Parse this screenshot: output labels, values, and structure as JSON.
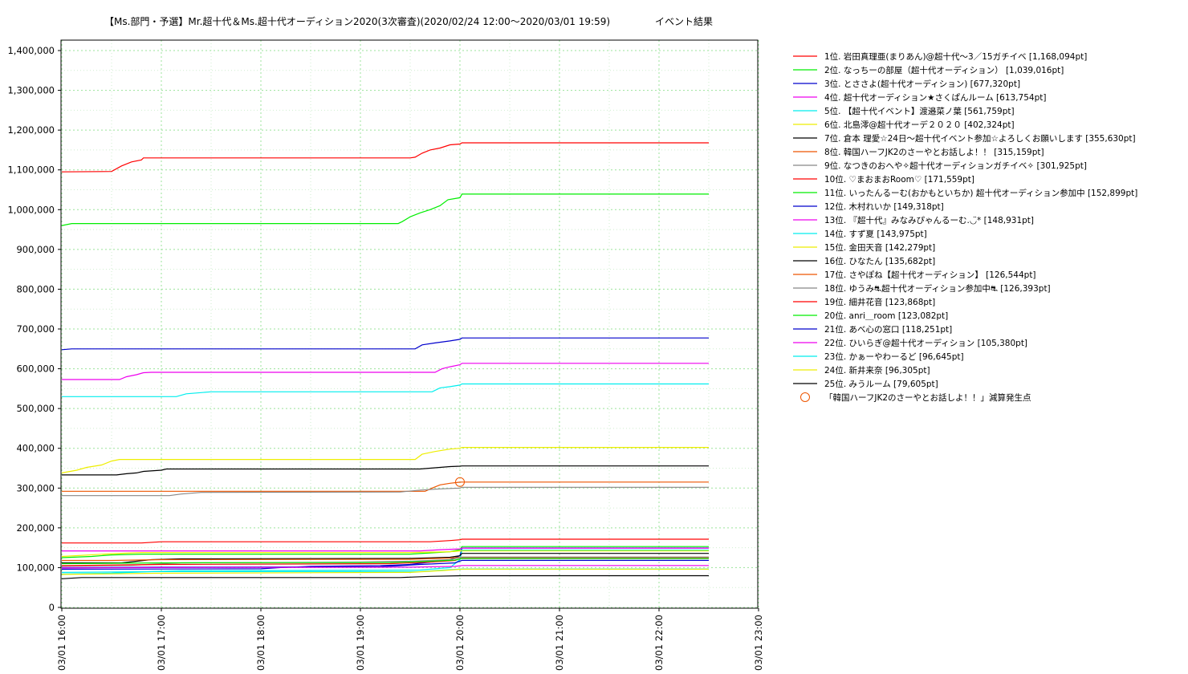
{
  "chart_data": {
    "type": "line",
    "title": "【Ms.部門・予選】Mr.超十代＆Ms.超十代オーディション2020(3次審査)(2020/02/24 12:00～2020/03/01 19:59)",
    "subtitle": "イベント結果",
    "xlabel": "",
    "ylabel": "",
    "x_tick_labels": [
      "03/01 16:00",
      "03/01 17:00",
      "03/01 18:00",
      "03/01 19:00",
      "03/01 20:00",
      "03/01 21:00",
      "03/01 22:00",
      "03/01 23:00"
    ],
    "y_tick_labels": [
      "0",
      "100,000",
      "200,000",
      "300,000",
      "400,000",
      "500,000",
      "600,000",
      "700,000",
      "800,000",
      "900,000",
      "1,000,000",
      "1,100,000",
      "1,200,000",
      "1,300,000",
      "1,400,000"
    ],
    "xlim": [
      0,
      7
    ],
    "ylim": [
      0,
      1420000
    ],
    "grid": true,
    "legend_position": "right",
    "series": [
      {
        "name": "1位. 岩田真理亜(まりあん)@超十代～3／15ガチイベ [1,168,094pt]",
        "color": "#ff0000",
        "points": [
          [
            0,
            1095000
          ],
          [
            0.5,
            1096000
          ],
          [
            0.6,
            1110000
          ],
          [
            0.7,
            1120000
          ],
          [
            0.8,
            1125000
          ],
          [
            0.82,
            1130000
          ],
          [
            3.5,
            1130000
          ],
          [
            3.55,
            1132000
          ],
          [
            3.62,
            1142000
          ],
          [
            3.7,
            1150000
          ],
          [
            3.8,
            1155000
          ],
          [
            3.9,
            1163000
          ],
          [
            4.0,
            1165000
          ],
          [
            4.02,
            1168094
          ],
          [
            6.5,
            1168094
          ]
        ]
      },
      {
        "name": "2位. なっちーの部屋（超十代オーディション） [1,039,016pt]",
        "color": "#00ee00",
        "points": [
          [
            0,
            960000
          ],
          [
            0.1,
            965000
          ],
          [
            3.38,
            965000
          ],
          [
            3.42,
            970000
          ],
          [
            3.5,
            982000
          ],
          [
            3.6,
            992000
          ],
          [
            3.7,
            1000000
          ],
          [
            3.8,
            1010000
          ],
          [
            3.88,
            1025000
          ],
          [
            4.0,
            1030000
          ],
          [
            4.02,
            1039016
          ],
          [
            6.5,
            1039016
          ]
        ]
      },
      {
        "name": "3位. とささよ(超十代オーディション) [677,320pt]",
        "color": "#0000cc",
        "points": [
          [
            0,
            648000
          ],
          [
            0.1,
            650000
          ],
          [
            3.55,
            650000
          ],
          [
            3.62,
            660000
          ],
          [
            3.75,
            665000
          ],
          [
            3.9,
            670000
          ],
          [
            4.0,
            674000
          ],
          [
            4.02,
            677320
          ],
          [
            6.5,
            677320
          ]
        ]
      },
      {
        "name": "4位. 超十代オーディション★さくぱんルーム [613,754pt]",
        "color": "#ee00ee",
        "points": [
          [
            0,
            573000
          ],
          [
            0.58,
            573000
          ],
          [
            0.65,
            580000
          ],
          [
            0.75,
            585000
          ],
          [
            0.82,
            590000
          ],
          [
            0.9,
            591000
          ],
          [
            3.75,
            591000
          ],
          [
            3.82,
            600000
          ],
          [
            3.9,
            605000
          ],
          [
            4.0,
            610000
          ],
          [
            4.02,
            613754
          ],
          [
            6.5,
            613754
          ]
        ]
      },
      {
        "name": "5位. 【超十代イベント】渡邉菜ノ葉 [561,759pt]",
        "color": "#00eeee",
        "points": [
          [
            0,
            530000
          ],
          [
            1.15,
            530000
          ],
          [
            1.25,
            537000
          ],
          [
            1.4,
            540000
          ],
          [
            1.5,
            542000
          ],
          [
            3.72,
            542000
          ],
          [
            3.8,
            552000
          ],
          [
            3.9,
            555000
          ],
          [
            4.0,
            559000
          ],
          [
            4.02,
            561759
          ],
          [
            6.5,
            561759
          ]
        ]
      },
      {
        "name": "6位. 北島澪@超十代オーデ２０２０ [402,324pt]",
        "color": "#eeee00",
        "points": [
          [
            0,
            338000
          ],
          [
            0.15,
            345000
          ],
          [
            0.25,
            352000
          ],
          [
            0.4,
            358000
          ],
          [
            0.5,
            368000
          ],
          [
            0.58,
            372000
          ],
          [
            3.55,
            372000
          ],
          [
            3.62,
            385000
          ],
          [
            3.75,
            392000
          ],
          [
            3.9,
            398000
          ],
          [
            4.0,
            400000
          ],
          [
            4.02,
            402324
          ],
          [
            6.5,
            402324
          ]
        ]
      },
      {
        "name": "7位. 倉本 理愛☆24日～超十代イベント参加☆よろしくお願いします [355,630pt]",
        "color": "#000000",
        "points": [
          [
            0,
            333000
          ],
          [
            0.55,
            333000
          ],
          [
            0.65,
            336000
          ],
          [
            0.75,
            338000
          ],
          [
            0.82,
            342000
          ],
          [
            1.0,
            345000
          ],
          [
            1.05,
            348000
          ],
          [
            3.6,
            348000
          ],
          [
            3.75,
            351000
          ],
          [
            3.9,
            354000
          ],
          [
            4.0,
            355000
          ],
          [
            4.02,
            355630
          ],
          [
            6.5,
            355630
          ]
        ]
      },
      {
        "name": "8位. 韓国ハーフJK2のさーやとお話しよ！！ [315,159pt]",
        "color": "#ee5500",
        "points": [
          [
            0,
            292000
          ],
          [
            3.65,
            292000
          ],
          [
            3.72,
            300000
          ],
          [
            3.8,
            308000
          ],
          [
            3.9,
            312000
          ],
          [
            4.0,
            315000
          ],
          [
            4.02,
            315159
          ],
          [
            6.5,
            315159
          ]
        ]
      },
      {
        "name": "9位. なつきのおへや✧超十代オーディションガチイベ✧ [301,925pt]",
        "color": "#888888",
        "points": [
          [
            0,
            281000
          ],
          [
            1.08,
            281000
          ],
          [
            1.2,
            285000
          ],
          [
            1.4,
            289000
          ],
          [
            3.4,
            290000
          ],
          [
            3.6,
            295000
          ],
          [
            3.8,
            298000
          ],
          [
            4.0,
            300000
          ],
          [
            4.02,
            301925
          ],
          [
            6.5,
            301925
          ]
        ]
      },
      {
        "name": "10位. ♡まおまおRoom♡ [171,559pt]",
        "color": "#ff0000",
        "points": [
          [
            0,
            162000
          ],
          [
            0.8,
            162000
          ],
          [
            1.0,
            165000
          ],
          [
            3.7,
            165000
          ],
          [
            3.9,
            168000
          ],
          [
            4.0,
            170000
          ],
          [
            4.02,
            171559
          ],
          [
            6.5,
            171559
          ]
        ]
      },
      {
        "name": "11位. いったんるーむ(おかもといちか) 超十代オーディション参加中 [152,899pt]",
        "color": "#00ee00",
        "points": [
          [
            0,
            125000
          ],
          [
            0.3,
            128000
          ],
          [
            0.5,
            132000
          ],
          [
            0.8,
            134000
          ],
          [
            3.5,
            134000
          ],
          [
            3.9,
            140000
          ],
          [
            4.0,
            145000
          ],
          [
            4.02,
            152899
          ],
          [
            6.5,
            152899
          ]
        ]
      },
      {
        "name": "12位. 木村れいか [149,318pt]",
        "color": "#0000cc",
        "points": [
          [
            0,
            96000
          ],
          [
            2.0,
            97000
          ],
          [
            2.2,
            100000
          ],
          [
            2.5,
            103000
          ],
          [
            3.2,
            105000
          ],
          [
            3.5,
            108000
          ],
          [
            3.9,
            120000
          ],
          [
            4.0,
            130000
          ],
          [
            4.02,
            149318
          ],
          [
            6.5,
            149318
          ]
        ]
      },
      {
        "name": "13位. 『超十代』みなみぴゃんるーむ.◡̈* [148,931pt]",
        "color": "#ee00ee",
        "points": [
          [
            0,
            142000
          ],
          [
            3.6,
            142000
          ],
          [
            3.8,
            145000
          ],
          [
            4.0,
            147000
          ],
          [
            4.02,
            148931
          ],
          [
            6.5,
            148931
          ]
        ]
      },
      {
        "name": "14位. すず夏 [143,975pt]",
        "color": "#00eeee",
        "points": [
          [
            0,
            84000
          ],
          [
            0.5,
            86000
          ],
          [
            0.9,
            90000
          ],
          [
            1.2,
            92000
          ],
          [
            3.6,
            94000
          ],
          [
            3.9,
            100000
          ],
          [
            4.0,
            120000
          ],
          [
            4.02,
            143975
          ],
          [
            6.5,
            143975
          ]
        ]
      },
      {
        "name": "15位. 金田天音 [142,279pt]",
        "color": "#eeee00",
        "points": [
          [
            0,
            128000
          ],
          [
            0.5,
            135000
          ],
          [
            0.8,
            138000
          ],
          [
            3.5,
            138000
          ],
          [
            3.9,
            140000
          ],
          [
            4.02,
            142279
          ],
          [
            6.5,
            142279
          ]
        ]
      },
      {
        "name": "16位. ひなたん [135,682pt]",
        "color": "#000000",
        "points": [
          [
            0,
            112000
          ],
          [
            0.6,
            112000
          ],
          [
            0.9,
            120000
          ],
          [
            1.2,
            122000
          ],
          [
            3.5,
            123000
          ],
          [
            3.9,
            126000
          ],
          [
            4.0,
            130000
          ],
          [
            4.02,
            135682
          ],
          [
            6.5,
            135682
          ]
        ]
      },
      {
        "name": "17位. さやぽね【超十代オーディション】 [126,544pt]",
        "color": "#ee5500",
        "points": [
          [
            0,
            118000
          ],
          [
            0.5,
            118000
          ],
          [
            1.0,
            120000
          ],
          [
            3.5,
            121000
          ],
          [
            3.9,
            124000
          ],
          [
            4.02,
            126544
          ],
          [
            6.5,
            126544
          ]
        ]
      },
      {
        "name": "18位. ゆうみ⛐超十代オーディション参加中⛐ [126,393pt]",
        "color": "#888888",
        "points": [
          [
            0,
            104000
          ],
          [
            0.7,
            106000
          ],
          [
            1.2,
            112000
          ],
          [
            3.0,
            114000
          ],
          [
            3.5,
            116000
          ],
          [
            3.9,
            120000
          ],
          [
            4.02,
            126393
          ],
          [
            6.5,
            126393
          ]
        ]
      },
      {
        "name": "19位. 細井花音 [123,868pt]",
        "color": "#ff0000",
        "points": [
          [
            0,
            105000
          ],
          [
            1.0,
            108000
          ],
          [
            3.3,
            110000
          ],
          [
            3.7,
            114000
          ],
          [
            3.95,
            118000
          ],
          [
            4.02,
            123868
          ],
          [
            6.5,
            123868
          ]
        ]
      },
      {
        "name": "20位. anri＿room [123,082pt]",
        "color": "#00ee00",
        "points": [
          [
            0,
            110000
          ],
          [
            1.0,
            112000
          ],
          [
            3.3,
            113000
          ],
          [
            3.7,
            116000
          ],
          [
            3.95,
            119000
          ],
          [
            4.02,
            123082
          ],
          [
            6.5,
            123082
          ]
        ]
      },
      {
        "name": "21位. あべ心の窓口 [118,251pt]",
        "color": "#0000cc",
        "points": [
          [
            0,
            100000
          ],
          [
            1.0,
            101000
          ],
          [
            3.2,
            102000
          ],
          [
            3.6,
            108000
          ],
          [
            3.95,
            112000
          ],
          [
            4.02,
            118251
          ],
          [
            6.5,
            118251
          ]
        ]
      },
      {
        "name": "22位. ひいらぎ@超十代オーディション [105,380pt]",
        "color": "#ee00ee",
        "points": [
          [
            0,
            99000
          ],
          [
            1.0,
            100000
          ],
          [
            3.5,
            101000
          ],
          [
            3.95,
            103000
          ],
          [
            4.02,
            105380
          ],
          [
            6.5,
            105380
          ]
        ]
      },
      {
        "name": "23位. かぁーやわーるど [96,645pt]",
        "color": "#00eeee",
        "points": [
          [
            0,
            88000
          ],
          [
            1.0,
            90000
          ],
          [
            3.6,
            90000
          ],
          [
            3.85,
            94000
          ],
          [
            4.02,
            96645
          ],
          [
            6.5,
            96645
          ]
        ]
      },
      {
        "name": "24位. 新井来奈 [96,305pt]",
        "color": "#eeee00",
        "points": [
          [
            0,
            83000
          ],
          [
            1.0,
            86000
          ],
          [
            3.5,
            88000
          ],
          [
            3.85,
            93000
          ],
          [
            4.02,
            96305
          ],
          [
            6.5,
            96305
          ]
        ]
      },
      {
        "name": "25位. みうルーム [79,605pt]",
        "color": "#000000",
        "points": [
          [
            0,
            72000
          ],
          [
            0.2,
            75000
          ],
          [
            3.4,
            75000
          ],
          [
            3.7,
            78000
          ],
          [
            4.02,
            79605
          ],
          [
            6.5,
            79605
          ]
        ]
      }
    ],
    "annotations": [
      {
        "label": "「韓国ハーフJK2のさーやとお話しよ！！」減算発生点",
        "x": 4.0,
        "y": 315159,
        "marker": "circle",
        "color": "#ee5500"
      }
    ]
  }
}
